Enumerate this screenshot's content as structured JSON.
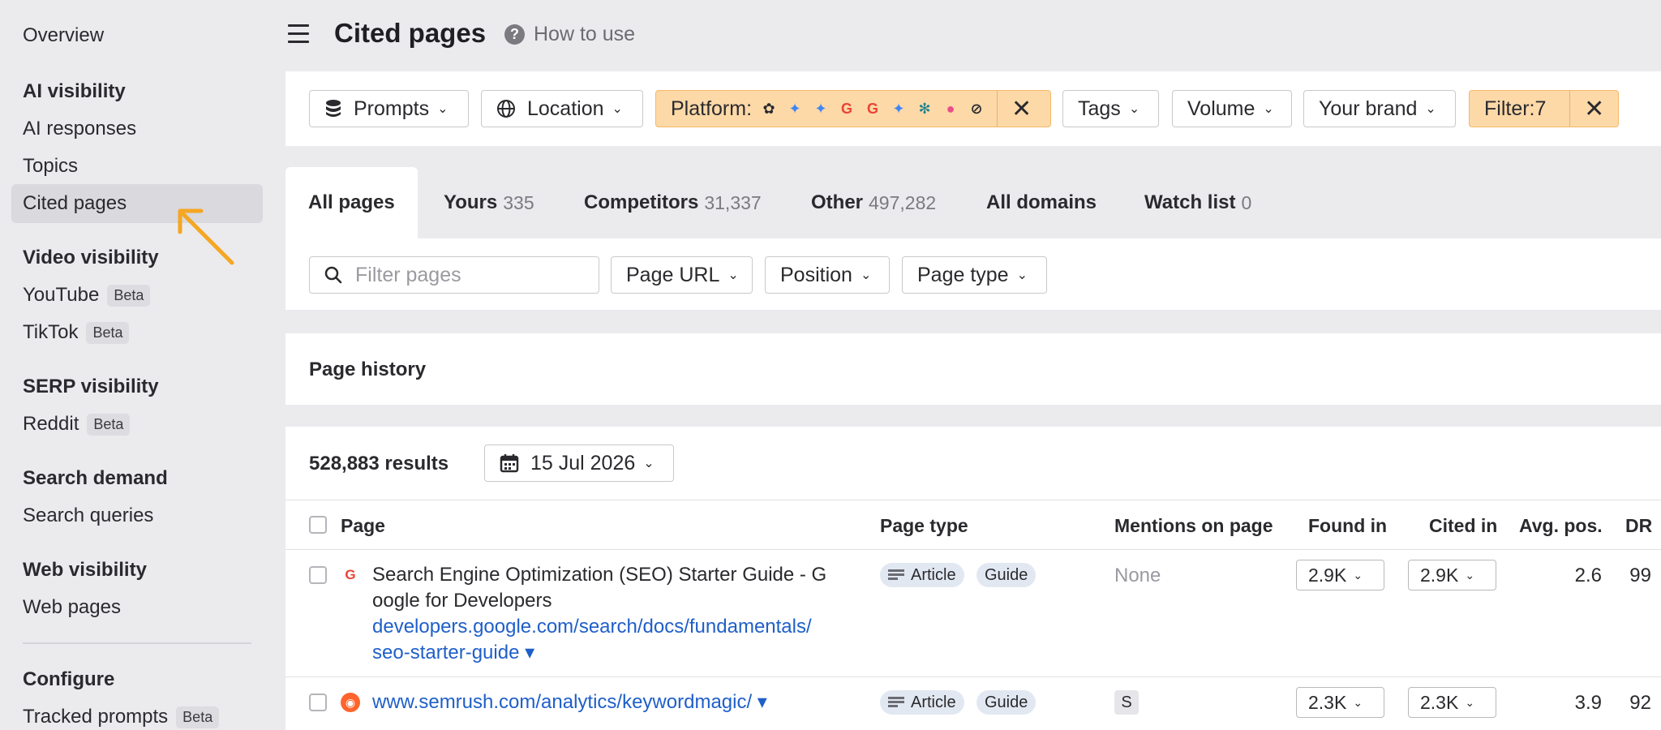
{
  "sidebar": {
    "overview": "Overview",
    "ai_visibility": {
      "heading": "AI visibility",
      "items": [
        "AI responses",
        "Topics",
        "Cited pages"
      ]
    },
    "video_visibility": {
      "heading": "Video visibility",
      "youtube": "YouTube",
      "tiktok": "TikTok",
      "beta": "Beta"
    },
    "serp_visibility": {
      "heading": "SERP visibility",
      "reddit": "Reddit"
    },
    "search_demand": {
      "heading": "Search demand",
      "items": [
        "Search queries"
      ]
    },
    "web_visibility": {
      "heading": "Web visibility",
      "items": [
        "Web pages"
      ]
    },
    "configure": {
      "heading": "Configure",
      "tracked_prompts": "Tracked prompts"
    }
  },
  "header": {
    "title": "Cited pages",
    "how_to_use": "How to use"
  },
  "filters": {
    "prompts": "Prompts",
    "location": "Location",
    "platform": "Platform:",
    "tags": "Tags",
    "volume": "Volume",
    "your_brand": "Your brand",
    "filter_count": "Filter:7"
  },
  "tabs": [
    {
      "label": "All pages",
      "count": ""
    },
    {
      "label": "Yours",
      "count": "335"
    },
    {
      "label": "Competitors",
      "count": "31,337"
    },
    {
      "label": "Other",
      "count": "497,282"
    },
    {
      "label": "All domains",
      "count": ""
    },
    {
      "label": "Watch list",
      "count": "0"
    }
  ],
  "search": {
    "placeholder": "Filter pages",
    "page_url": "Page URL",
    "position": "Position",
    "page_type": "Page type"
  },
  "history": {
    "title": "Page history"
  },
  "results": {
    "count": "528,883 results",
    "date": "15 Jul 2026"
  },
  "table": {
    "columns": {
      "page": "Page",
      "page_type": "Page type",
      "mentions": "Mentions on page",
      "found_in": "Found in",
      "cited_in": "Cited in",
      "avg_pos": "Avg. pos.",
      "dr": "DR"
    },
    "rows": [
      {
        "title_line1": "Search Engine Optimization (SEO) Starter Guide - G",
        "title_line2": "oogle for Developers",
        "url_line1": "developers.google.com/search/docs/fundamentals/",
        "url_line2": "seo-starter-guide ▾",
        "type1": "Article",
        "type2": "Guide",
        "mentions": "None",
        "found_in": "2.9K",
        "cited_in": "2.9K",
        "avg_pos": "2.6",
        "dr": "99"
      },
      {
        "url": "www.semrush.com/analytics/keywordmagic/ ▾",
        "type1": "Article",
        "type2": "Guide",
        "mentions": "S",
        "found_in": "2.3K",
        "cited_in": "2.3K",
        "avg_pos": "3.9",
        "dr": "92"
      }
    ]
  },
  "colors": {
    "accent_orange": "#fdd9a8",
    "link_blue": "#1f5fc9",
    "arrow": "#f5a623"
  }
}
